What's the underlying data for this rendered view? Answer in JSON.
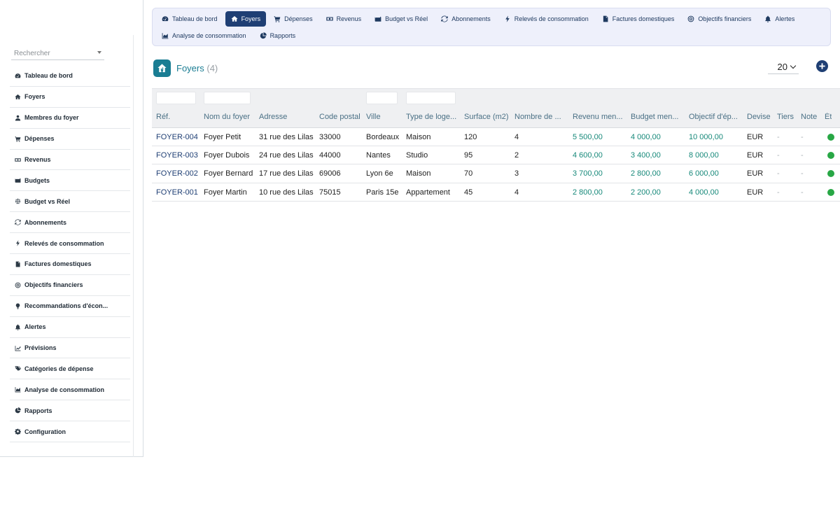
{
  "search": {
    "placeholder": "Rechercher"
  },
  "sidebar": {
    "items": [
      {
        "label": "Tableau de bord",
        "icon": "dashboard-icon"
      },
      {
        "label": "Foyers",
        "icon": "home-icon"
      },
      {
        "label": "Membres du foyer",
        "icon": "user-icon"
      },
      {
        "label": "Dépenses",
        "icon": "cart-icon"
      },
      {
        "label": "Revenus",
        "icon": "money-icon"
      },
      {
        "label": "Budgets",
        "icon": "wallet-icon"
      },
      {
        "label": "Budget vs Réel",
        "icon": "balance-icon"
      },
      {
        "label": "Abonnements",
        "icon": "sync-icon"
      },
      {
        "label": "Relevés de consommation",
        "icon": "bolt-icon"
      },
      {
        "label": "Factures domestiques",
        "icon": "invoice-icon"
      },
      {
        "label": "Objectifs financiers",
        "icon": "target-icon"
      },
      {
        "label": "Recommandations d'écon...",
        "icon": "lightbulb-icon"
      },
      {
        "label": "Alertes",
        "icon": "bell-icon"
      },
      {
        "label": "Prévisions",
        "icon": "trend-icon"
      },
      {
        "label": "Catégories de dépense",
        "icon": "tags-icon"
      },
      {
        "label": "Analyse de consommation",
        "icon": "area-chart-icon"
      },
      {
        "label": "Rapports",
        "icon": "pie-chart-icon"
      },
      {
        "label": "Configuration",
        "icon": "gear-icon"
      }
    ]
  },
  "topnav": {
    "row1": [
      {
        "label": "Tableau de bord",
        "icon": "dashboard-icon",
        "active": false
      },
      {
        "label": "Foyers",
        "icon": "home-icon",
        "active": true
      },
      {
        "label": "Dépenses",
        "icon": "cart-icon",
        "active": false
      },
      {
        "label": "Revenus",
        "icon": "money-icon",
        "active": false
      },
      {
        "label": "Budget vs Réel",
        "icon": "wallet-icon",
        "active": false
      },
      {
        "label": "Abonnements",
        "icon": "sync-icon",
        "active": false
      },
      {
        "label": "Relevés de consommation",
        "icon": "bolt-icon",
        "active": false
      },
      {
        "label": "Factures domestiques",
        "icon": "invoice-icon",
        "active": false
      },
      {
        "label": "Objectifs financiers",
        "icon": "target-icon",
        "active": false
      },
      {
        "label": "Alertes",
        "icon": "bell-icon",
        "active": false
      }
    ],
    "row2": [
      {
        "label": "Analyse de consommation",
        "icon": "area-chart-icon",
        "active": false
      },
      {
        "label": "Rapports",
        "icon": "pie-chart-icon",
        "active": false
      }
    ]
  },
  "header": {
    "title": "Foyers",
    "count": "(4)",
    "page_size": "20"
  },
  "table": {
    "columns": [
      "Réf.",
      "Nom du foyer",
      "Adresse",
      "Code postal",
      "Ville",
      "Type de loge...",
      "Surface (m2)",
      "Nombre de ...",
      "Revenu men...",
      "Budget men...",
      "Objectif d'ép...",
      "Devise",
      "Tiers",
      "Note",
      "Ét"
    ],
    "rows": [
      [
        "FOYER-004",
        "Foyer Petit",
        "31 rue des Lilas",
        "33000",
        "Bordeaux",
        "Maison",
        "120",
        "4",
        "5 500,00",
        "4 000,00",
        "10 000,00",
        "EUR",
        "-",
        "-"
      ],
      [
        "FOYER-003",
        "Foyer Dubois",
        "24 rue des Lilas",
        "44000",
        "Nantes",
        "Studio",
        "95",
        "2",
        "4 600,00",
        "3 400,00",
        "8 000,00",
        "EUR",
        "-",
        "-"
      ],
      [
        "FOYER-002",
        "Foyer Bernard",
        "17 rue des Lilas",
        "69006",
        "Lyon 6e",
        "Maison",
        "70",
        "3",
        "3 700,00",
        "2 800,00",
        "6 000,00",
        "EUR",
        "-",
        "-"
      ],
      [
        "FOYER-001",
        "Foyer Martin",
        "10 rue des Lilas",
        "75015",
        "Paris 15e",
        "Appartement",
        "45",
        "4",
        "2 800,00",
        "2 200,00",
        "4 000,00",
        "EUR",
        "-",
        "-"
      ]
    ],
    "status_color": "#28a745"
  },
  "colors": {
    "accent": "#1f3f74",
    "teal": "#1a7d93",
    "amount": "#17897a"
  }
}
